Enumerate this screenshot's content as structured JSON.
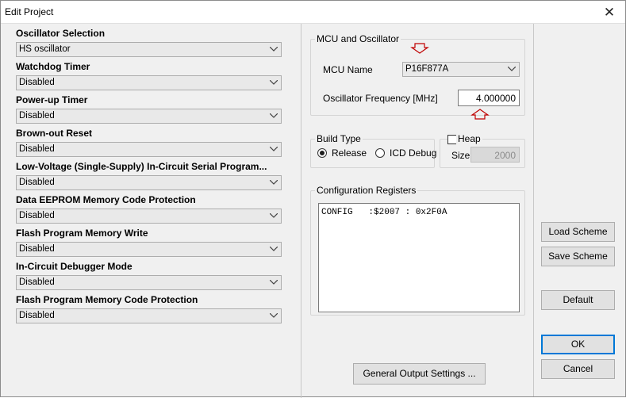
{
  "window": {
    "title": "Edit Project",
    "close_glyph": "✕"
  },
  "settings": [
    {
      "label": "Oscillator Selection",
      "value": "HS oscillator"
    },
    {
      "label": "Watchdog Timer",
      "value": "Disabled"
    },
    {
      "label": "Power-up Timer",
      "value": "Disabled"
    },
    {
      "label": "Brown-out Reset",
      "value": "Disabled"
    },
    {
      "label": "Low-Voltage (Single-Supply) In-Circuit Serial Program...",
      "value": "Disabled"
    },
    {
      "label": "Data EEPROM Memory Code Protection",
      "value": "Disabled"
    },
    {
      "label": "Flash Program Memory Write",
      "value": "Disabled"
    },
    {
      "label": "In-Circuit Debugger Mode",
      "value": "Disabled"
    },
    {
      "label": "Flash Program Memory Code Protection",
      "value": "Disabled"
    }
  ],
  "mcu": {
    "group_title": "MCU and Oscillator",
    "name_label": "MCU Name",
    "name_value": "P16F877A",
    "freq_label": "Oscillator Frequency [MHz]",
    "freq_value": "4.000000"
  },
  "build_type": {
    "group_title": "Build Type",
    "release_label": "Release",
    "icd_label": "ICD Debug",
    "selected": "Release"
  },
  "heap": {
    "label": "Heap",
    "checked": false,
    "size_label": "Size",
    "size_value": "2000"
  },
  "config": {
    "group_title": "Configuration Registers",
    "content": "CONFIG   :$2007 : 0x2F0A"
  },
  "buttons": {
    "general_output": "General Output Settings ...",
    "load_scheme": "Load Scheme",
    "save_scheme": "Save Scheme",
    "default": "Default",
    "ok": "OK",
    "cancel": "Cancel"
  },
  "annotation_color": "#c00000"
}
